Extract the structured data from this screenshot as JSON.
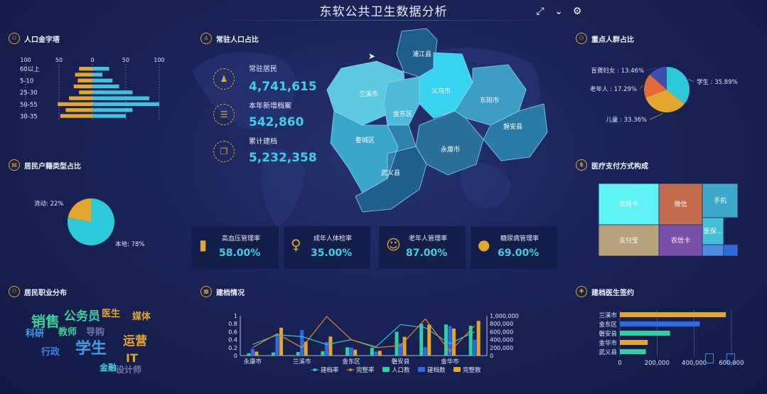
{
  "header": {
    "title": "东软公共卫生数据分析"
  },
  "toolbar": {
    "expand_icon": "expand-icon",
    "chevron_icon": "chevron-down-icon",
    "gear_icon": "gear-icon"
  },
  "panels": {
    "pyramid": "人口金字塔",
    "resident": "常驻人口占比",
    "key_groups": "重点人群占比",
    "household": "居民户籍类型占比",
    "payment": "医疗支付方式构成",
    "occupation": "居民职业分布",
    "records": "建档情况",
    "doctor": "建档医生签约"
  },
  "stats": [
    {
      "label": "常驻居民",
      "value": "4,741,615"
    },
    {
      "label": "本年新增档案",
      "value": "542,860"
    },
    {
      "label": "累计建档",
      "value": "5,232,358"
    }
  ],
  "kpis": [
    {
      "label": "高血压管理率",
      "value": "58.00%"
    },
    {
      "label": "成年人体检率",
      "value": "35.00%"
    },
    {
      "label": "老年人管理率",
      "value": "87.00%"
    },
    {
      "label": "糖尿病管理率",
      "value": "69.00%"
    }
  ],
  "map_regions": [
    "浦江县",
    "兰溪市",
    "义乌市",
    "金东区",
    "东阳市",
    "磐安县",
    "婺城区",
    "永康市",
    "武义县"
  ],
  "word_cloud": [
    {
      "text": "销售",
      "color": "#3fcf9a"
    },
    {
      "text": "公务员",
      "color": "#3fcf9a"
    },
    {
      "text": "医生",
      "color": "#e3a62f"
    },
    {
      "text": "媒体",
      "color": "#e3a62f"
    },
    {
      "text": "科研",
      "color": "#3fa0e6"
    },
    {
      "text": "教师",
      "color": "#3fcf9a"
    },
    {
      "text": "导购",
      "color": "#6a78a8"
    },
    {
      "text": "学生",
      "color": "#3fa0e6"
    },
    {
      "text": "运营",
      "color": "#e3a62f"
    },
    {
      "text": "行政",
      "color": "#3f7fe6"
    },
    {
      "text": "IT",
      "color": "#e3a62f"
    },
    {
      "text": "金融",
      "color": "#3fd0e6"
    },
    {
      "text": "设计师",
      "color": "#6a78a8"
    }
  ],
  "chart_data": [
    {
      "type": "bar",
      "id": "pyramid",
      "orientation": "horizontal",
      "categories": [
        "30-35",
        "",
        "50-55",
        "",
        "25-30",
        "",
        "5-10",
        "",
        "60以上"
      ],
      "series": [
        {
          "values": [
            48,
            40,
            52,
            35,
            20,
            28,
            22,
            26,
            20
          ],
          "color": "#e3a62f"
        },
        {
          "values": [
            50,
            60,
            100,
            85,
            60,
            40,
            30,
            15,
            25
          ],
          "color": "#3fc4de"
        }
      ],
      "xticks": [
        "150",
        "100",
        "50",
        "0",
        "50",
        "100",
        "150"
      ],
      "xlim": [
        -150,
        150
      ]
    },
    {
      "type": "pie",
      "id": "key_groups",
      "slices": [
        {
          "label": "学生 : 35.89%",
          "value": 35.89,
          "color": "#2ec9d8"
        },
        {
          "label": "儿童 : 33.36%",
          "value": 33.36,
          "color": "#e3a62f"
        },
        {
          "label": "老年人 : 17.29%",
          "value": 17.29,
          "color": "#e26a3c"
        },
        {
          "label": "盲聋妇女 : 13.46%",
          "value": 13.46,
          "color": "#3a4fb0"
        }
      ]
    },
    {
      "type": "pie",
      "id": "household",
      "slices": [
        {
          "label": "本地: 78%",
          "value": 78,
          "color": "#2ec9d8"
        },
        {
          "label": "流动: 22%",
          "value": 22,
          "color": "#e3a62f"
        }
      ]
    },
    {
      "type": "treemap",
      "id": "payment",
      "cells": [
        {
          "label": "信用卡",
          "value": 26,
          "color": "#5ef2f2"
        },
        {
          "label": "微信",
          "value": 19,
          "color": "#c26b4d"
        },
        {
          "label": "手机",
          "value": 8,
          "color": "#3fa9c9"
        },
        {
          "label": "支付宝",
          "value": 22,
          "color": "#b8a27c"
        },
        {
          "label": "农信卡",
          "value": 14,
          "color": "#7a4fa8"
        },
        {
          "label": "医保...",
          "value": 6,
          "color": "#43bfd8"
        },
        {
          "label": "",
          "value": 3,
          "color": "#4b8be0"
        },
        {
          "label": "",
          "value": 2,
          "color": "#2f6bd9"
        }
      ]
    },
    {
      "type": "bar",
      "id": "records",
      "categories": [
        "永康市",
        "",
        "兰溪市",
        "",
        "金东区",
        "",
        "磐安县",
        "",
        "金华市",
        ""
      ],
      "xlabels": [
        "永康市",
        "兰溪市",
        "金东区",
        "磐安县",
        "金华市"
      ],
      "series": [
        {
          "name": "人口数",
          "values": [
            60000,
            80000,
            90000,
            110000,
            210000,
            200000,
            600000,
            800000,
            780000,
            750000
          ],
          "color": "#2ed0a8"
        },
        {
          "name": "建档数",
          "values": [
            170000,
            510000,
            640000,
            340000,
            200000,
            100000,
            310000,
            210000,
            740000,
            400000
          ],
          "color": "#2f6be0"
        },
        {
          "name": "完整数",
          "values": [
            100000,
            700000,
            350000,
            480000,
            150000,
            120000,
            470000,
            780000,
            680000,
            870000
          ],
          "color": "#e3a62f"
        }
      ],
      "lines": [
        {
          "name": "建档率",
          "values": [
            0.28,
            0.52,
            0.48,
            0.28,
            0.4,
            0.22,
            0.78,
            0.7,
            0.3,
            0.6
          ],
          "color": "#2ec9d8"
        },
        {
          "name": "完整率",
          "values": [
            0.2,
            0.55,
            0.2,
            0.98,
            0.4,
            0.2,
            0.25,
            0.92,
            0.1,
            0.75
          ],
          "color": "#d98b2a"
        }
      ],
      "yticks_left": [
        "0",
        "0.2",
        "0.4",
        "0.6",
        "0.8",
        "1"
      ],
      "yticks_right": [
        "0",
        "200,000",
        "400,000",
        "600,000",
        "800,000",
        "1,000,000"
      ],
      "ylim_left": [
        0,
        1
      ],
      "ylim_right": [
        0,
        1000000
      ]
    },
    {
      "type": "bar",
      "id": "doctor",
      "orientation": "horizontal",
      "categories": [
        "兰溪市",
        "金东区",
        "磐安县",
        "金华市",
        "武义县"
      ],
      "values": [
        570000,
        430000,
        270000,
        150000,
        140000
      ],
      "colors": [
        "#e3a62f",
        "#2f6be0",
        "#2ed0a8",
        "#e3a62f",
        "#2ed0a8"
      ],
      "xticks": [
        "0",
        "200,000",
        "400,000",
        "600,000"
      ],
      "xlim": [
        0,
        650000
      ]
    }
  ]
}
